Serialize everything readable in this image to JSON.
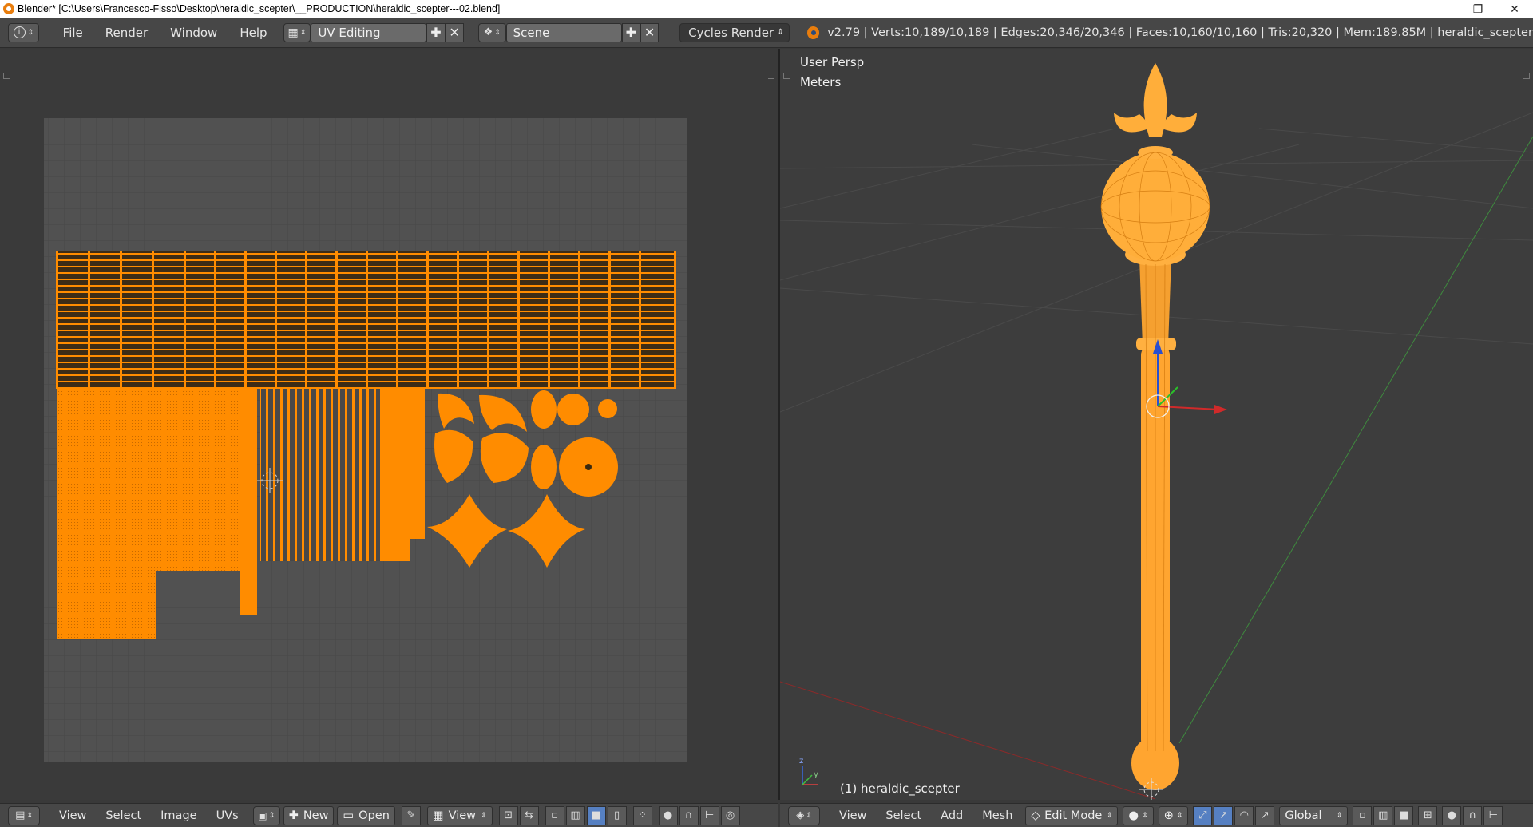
{
  "titlebar": {
    "title": "Blender* [C:\\Users\\Francesco-Fisso\\Desktop\\heraldic_scepter\\__PRODUCTION\\heraldic_scepter---02.blend]",
    "minimize": "—",
    "maximize": "❐",
    "close": "✕"
  },
  "topheader": {
    "menus": [
      "File",
      "Render",
      "Window",
      "Help"
    ],
    "screen_layout": "UV Editing",
    "scene": "Scene",
    "render_engine": "Cycles Render",
    "stats": "v2.79 | Verts:10,189/10,189 | Edges:20,346/20,346 | Faces:10,160/10,160 | Tris:20,320 | Mem:189.85M | heraldic_scepter"
  },
  "view3d": {
    "view_name": "User Persp",
    "units": "Meters",
    "object_label": "(1) heraldic_scepter"
  },
  "uv_header": {
    "menus": [
      "View",
      "Select",
      "Image",
      "UVs"
    ],
    "new_label": "New",
    "open_label": "Open",
    "view_label": "View"
  },
  "v3d_header": {
    "menus": [
      "View",
      "Select",
      "Add",
      "Mesh"
    ],
    "mode": "Edit Mode",
    "orientation": "Global"
  },
  "colors": {
    "uv_orange": "#ff8c00",
    "wire_orange": "#ffa530",
    "grid_bg": "#505050"
  }
}
